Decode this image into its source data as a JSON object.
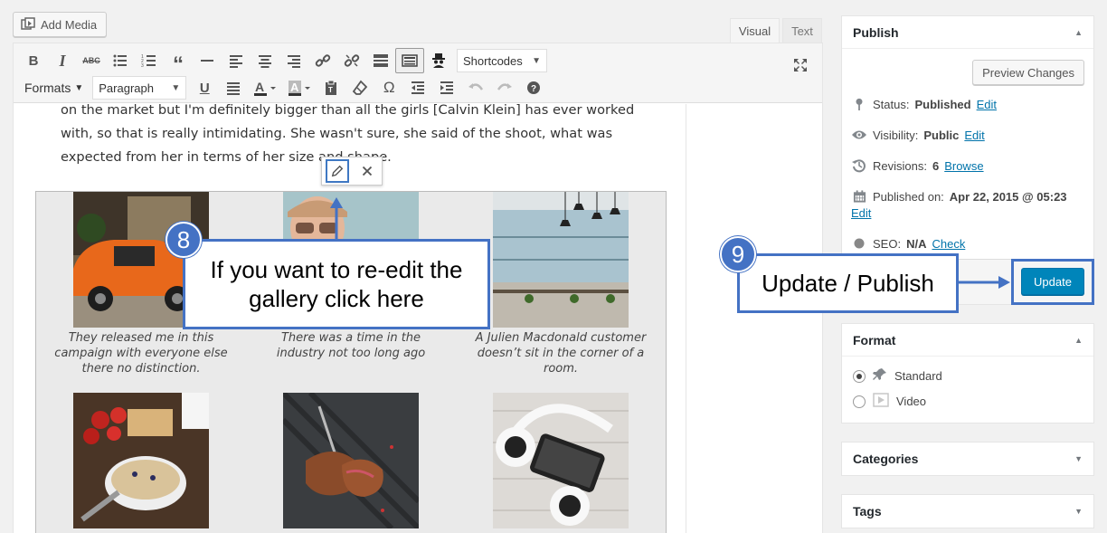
{
  "editor": {
    "add_media_label": "Add Media",
    "tabs": {
      "visual": "Visual",
      "text": "Text"
    },
    "toolbar": {
      "shortcodes_label": "Shortcodes",
      "formats_label": "Formats",
      "paragraph_label": "Paragraph",
      "row1_icons": [
        "bold-icon",
        "italic-icon",
        "strikethrough-icon",
        "bullet-list-icon",
        "numbered-list-icon",
        "blockquote-icon",
        "horizontal-line-icon",
        "align-left-icon",
        "align-center-icon",
        "align-right-icon",
        "link-icon",
        "unlink-icon",
        "read-more-icon",
        "toolbar-toggle-icon",
        "spy-icon"
      ],
      "row2_icons": [
        "underline-icon",
        "justify-icon",
        "text-color-icon",
        "background-color-icon",
        "paste-text-icon",
        "clear-formatting-icon",
        "special-character-icon",
        "outdent-icon",
        "indent-icon",
        "undo-icon",
        "redo-icon",
        "help-icon"
      ]
    },
    "content": {
      "lines": [
        "on the market but I'm definitely bigger than all the girls [Calvin Klein] has ever worked",
        "with, so that is really intimidating. She wasn't sure, she said of the shoot, what was",
        "expected from her in terms of her size and shape."
      ],
      "gallery": [
        {
          "caption": "They released me in this campaign with everyone else there no distinction.",
          "image": "orange-car"
        },
        {
          "caption": "There was a time in the industry not too long ago",
          "image": "woman-sunglasses"
        },
        {
          "caption": "A Julien Macdonald customer doesn’t sit in the corner of a room.",
          "image": "restaurant-interior"
        },
        {
          "caption": "",
          "image": "breakfast-bowl"
        },
        {
          "caption": "",
          "image": "grilled-steak"
        },
        {
          "caption": "",
          "image": "headphones-phone"
        }
      ]
    }
  },
  "annotations": {
    "step8": {
      "number": "8",
      "text": "If you want to re-edit the gallery click here"
    },
    "step9": {
      "number": "9",
      "text": "Update / Publish"
    }
  },
  "publish": {
    "title": "Publish",
    "preview_label": "Preview Changes",
    "status_label": "Status:",
    "status_value": "Published",
    "status_edit": "Edit",
    "visibility_label": "Visibility:",
    "visibility_value": "Public",
    "visibility_edit": "Edit",
    "revisions_label": "Revisions:",
    "revisions_value": "6",
    "revisions_link": "Browse",
    "published_label": "Published on:",
    "published_value": "Apr 22, 2015 @ 05:23",
    "published_edit": "Edit",
    "seo_label": "SEO:",
    "seo_value": "N/A",
    "seo_link": "Check",
    "update_label": "Update"
  },
  "format": {
    "title": "Format",
    "options": [
      {
        "label": "Standard",
        "selected": true
      },
      {
        "label": "Video",
        "selected": false
      }
    ]
  },
  "categories": {
    "title": "Categories"
  },
  "tags": {
    "title": "Tags"
  },
  "colors": {
    "accent": "#4472c4",
    "wp_blue": "#0085ba",
    "link": "#0073aa"
  }
}
